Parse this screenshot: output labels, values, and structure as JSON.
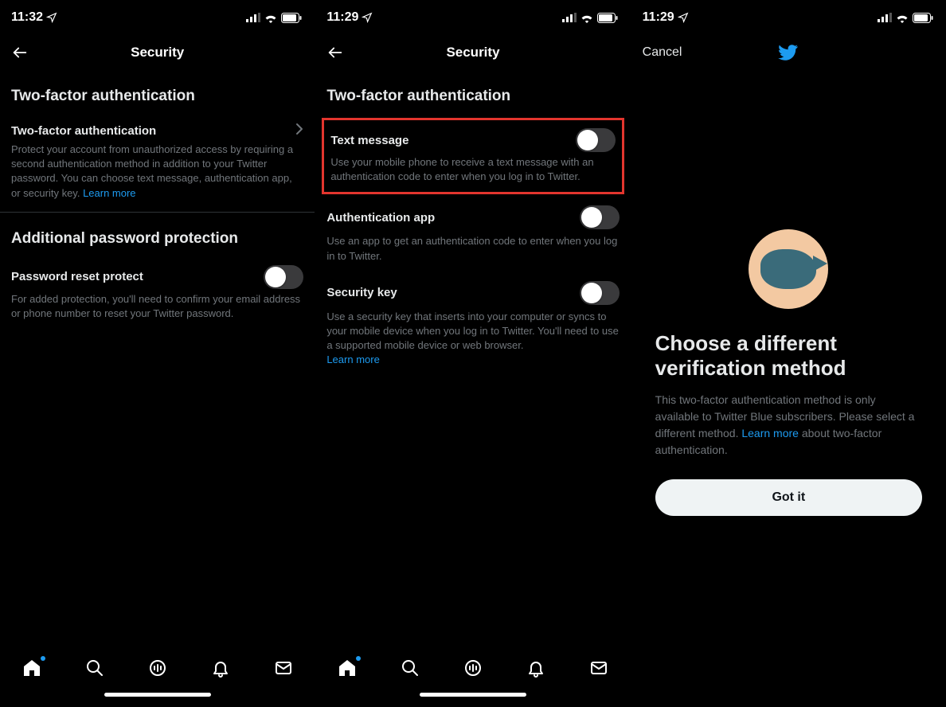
{
  "screen1": {
    "status": {
      "time": "11:32"
    },
    "nav": {
      "title": "Security"
    },
    "section_twofactor_title": "Two-factor authentication",
    "twofactor_row_title": "Two-factor authentication",
    "twofactor_desc_pre": "Protect your account from unauthorized access by requiring a second authentication method in addition to your Twitter password. You can choose text message, authentication app, or security key. ",
    "twofactor_learn_more": "Learn more",
    "section_additional_title": "Additional password protection",
    "pwreset_row_title": "Password reset protect",
    "pwreset_desc": "For added protection, you'll need to confirm your email address or phone number to reset your Twitter password."
  },
  "screen2": {
    "status": {
      "time": "11:29"
    },
    "nav": {
      "title": "Security"
    },
    "section_title": "Two-factor authentication",
    "text_message": {
      "title": "Text message",
      "desc": "Use your mobile phone to receive a text message with an authentication code to enter when you log in to Twitter."
    },
    "auth_app": {
      "title": "Authentication app",
      "desc": "Use an app to get an authentication code to enter when you log in to Twitter."
    },
    "security_key": {
      "title": "Security key",
      "desc_pre": "Use a security key that inserts into your computer or syncs to your mobile device when you log in to Twitter. You'll need to use a supported mobile device or web browser. ",
      "learn_more": "Learn more"
    }
  },
  "screen3": {
    "status": {
      "time": "11:29"
    },
    "nav": {
      "cancel_label": "Cancel"
    },
    "title": "Choose a different verification method",
    "desc_pre": "This two-factor authentication method is only available to Twitter Blue subscribers. Please select a different method. ",
    "learn_more": "Learn more",
    "desc_post": " about two-factor authentication.",
    "button_label": "Got it"
  }
}
